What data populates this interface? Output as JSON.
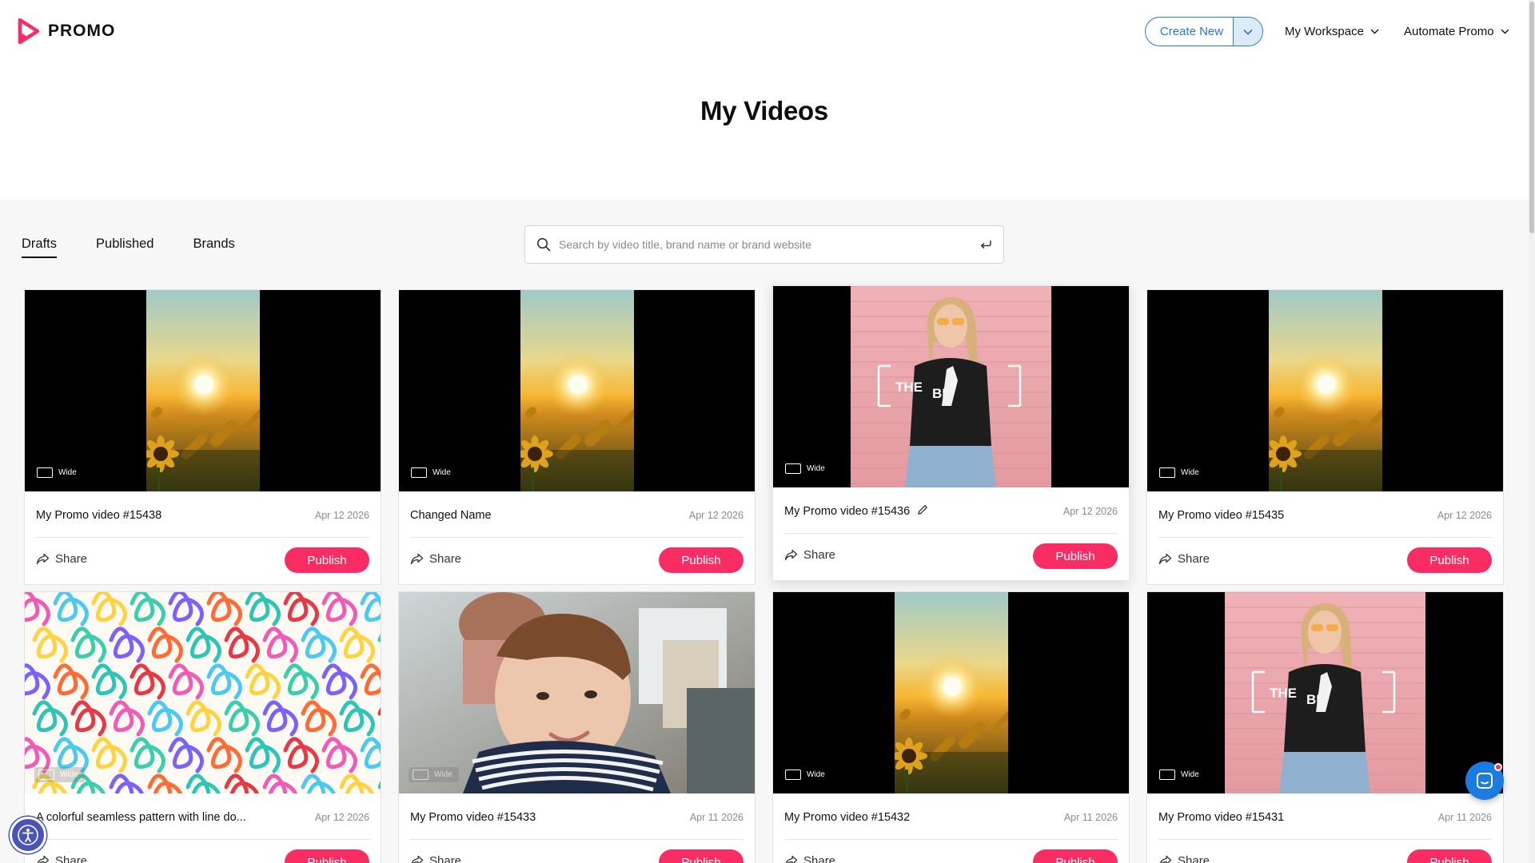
{
  "brand": {
    "name": "PROMO",
    "accent": "#f92d64",
    "link": "#2b78c9"
  },
  "header": {
    "create_new": "Create New",
    "workspace": "My Workspace",
    "automate": "Automate Promo"
  },
  "page_title": "My Videos",
  "tabs": [
    {
      "label": "Drafts",
      "active": true
    },
    {
      "label": "Published",
      "active": false
    },
    {
      "label": "Brands",
      "active": false
    }
  ],
  "search": {
    "placeholder": "Search by video title, brand name or brand website"
  },
  "cards": [
    {
      "title": "My Promo video #15438",
      "date": "Apr 12 2026",
      "badge": "Wide",
      "thumb": "sunflower-sunset",
      "share": "Share",
      "publish": "Publish"
    },
    {
      "title": "Changed Name",
      "date": "Apr 12 2026",
      "badge": "Wide",
      "thumb": "sunflower-sunset",
      "share": "Share",
      "publish": "Publish"
    },
    {
      "title": "My Promo video #15436",
      "date": "Apr 12 2026",
      "badge": "Wide",
      "thumb": "woman-pink-wall",
      "share": "Share",
      "publish": "Publish",
      "editable": true
    },
    {
      "title": "My Promo video #15435",
      "date": "Apr 12 2026",
      "badge": "Wide",
      "thumb": "sunflower-sunset",
      "share": "Share",
      "publish": "Publish"
    },
    {
      "title": "A colorful seamless pattern with line do...",
      "date": "Apr 12 2026",
      "badge": "Wide",
      "thumb": "colorful-pattern",
      "share": "Share",
      "publish": "Publish"
    },
    {
      "title": "My Promo video #15433",
      "date": "Apr 11 2026",
      "badge": "Wide",
      "thumb": "child-closeup",
      "share": "Share",
      "publish": "Publish"
    },
    {
      "title": "My Promo video #15432",
      "date": "Apr 11 2026",
      "badge": "Wide",
      "thumb": "sunflower-sunset",
      "share": "Share",
      "publish": "Publish"
    },
    {
      "title": "My Promo video #15431",
      "date": "Apr 11 2026",
      "badge": "Wide",
      "thumb": "woman-pink-wall",
      "share": "Share",
      "publish": "Publish"
    }
  ],
  "thumb_text": {
    "tshirt": "THE BE"
  }
}
